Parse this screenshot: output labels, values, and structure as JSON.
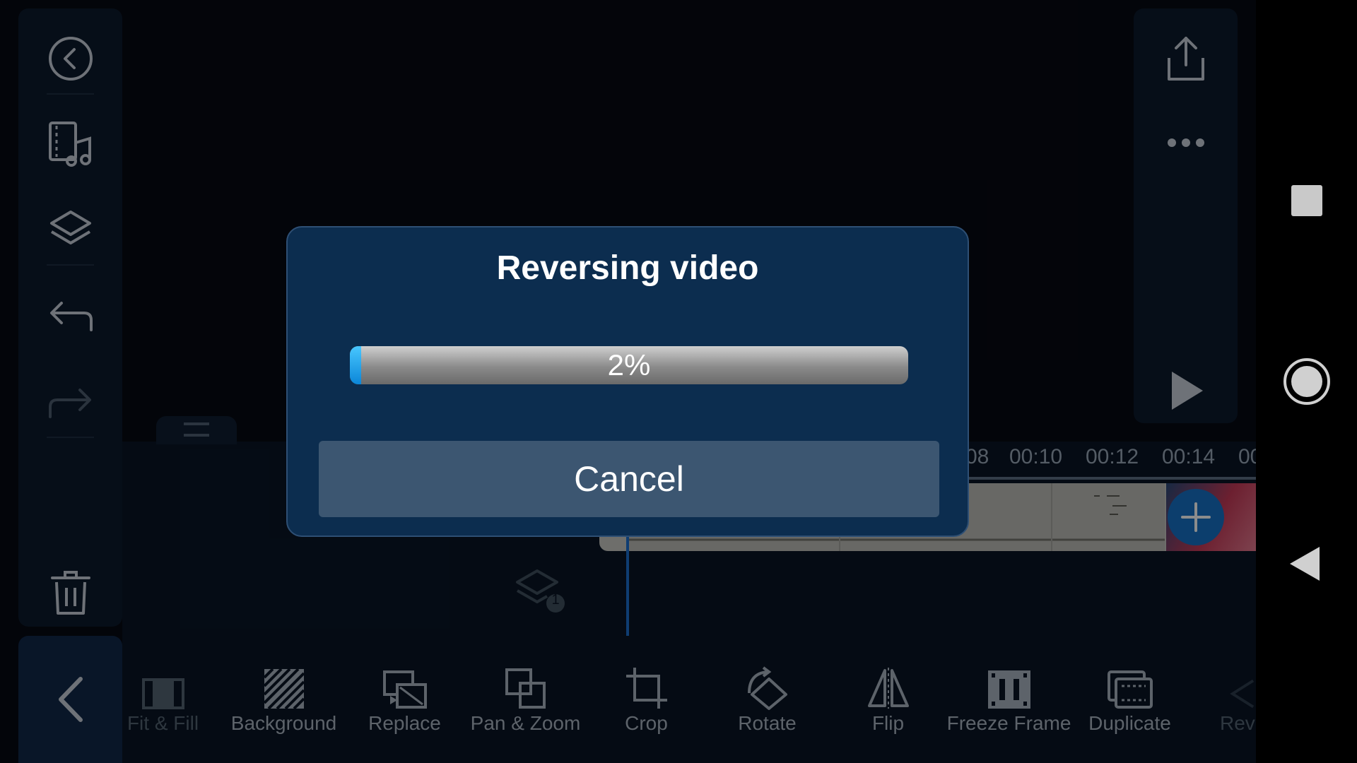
{
  "dialog": {
    "title": "Reversing video",
    "progress_text": "2%",
    "progress_value": 0.02,
    "cancel_label": "Cancel"
  },
  "timeline": {
    "ruler_labels": [
      "08",
      "00:10",
      "00:12",
      "00:14",
      "00"
    ],
    "layer_count": "1"
  },
  "left_rail": [
    "back-circle-icon",
    "media-icon",
    "layers-icon",
    "undo-icon",
    "redo-icon",
    "trash-icon"
  ],
  "right_rail": [
    "export-icon",
    "more-icon",
    "play-icon"
  ],
  "toolbar": {
    "items": [
      {
        "label": "Fit & Fill",
        "icon": "fit-fill-icon"
      },
      {
        "label": "Background",
        "icon": "background-icon"
      },
      {
        "label": "Replace",
        "icon": "replace-icon"
      },
      {
        "label": "Pan & Zoom",
        "icon": "pan-zoom-icon"
      },
      {
        "label": "Crop",
        "icon": "crop-icon"
      },
      {
        "label": "Rotate",
        "icon": "rotate-icon"
      },
      {
        "label": "Flip",
        "icon": "flip-icon"
      },
      {
        "label": "Freeze Frame",
        "icon": "freeze-frame-icon"
      },
      {
        "label": "Duplicate",
        "icon": "duplicate-icon"
      },
      {
        "label": "Rev",
        "icon": "reverse-icon"
      }
    ]
  },
  "system_nav": [
    "recents-icon",
    "home-icon",
    "back-triangle-icon"
  ],
  "colors": {
    "accent": "#1672c7",
    "progress": "#1a9be8",
    "dialog_bg": "#0c2d4f",
    "cancel_bg": "#3c5671"
  }
}
